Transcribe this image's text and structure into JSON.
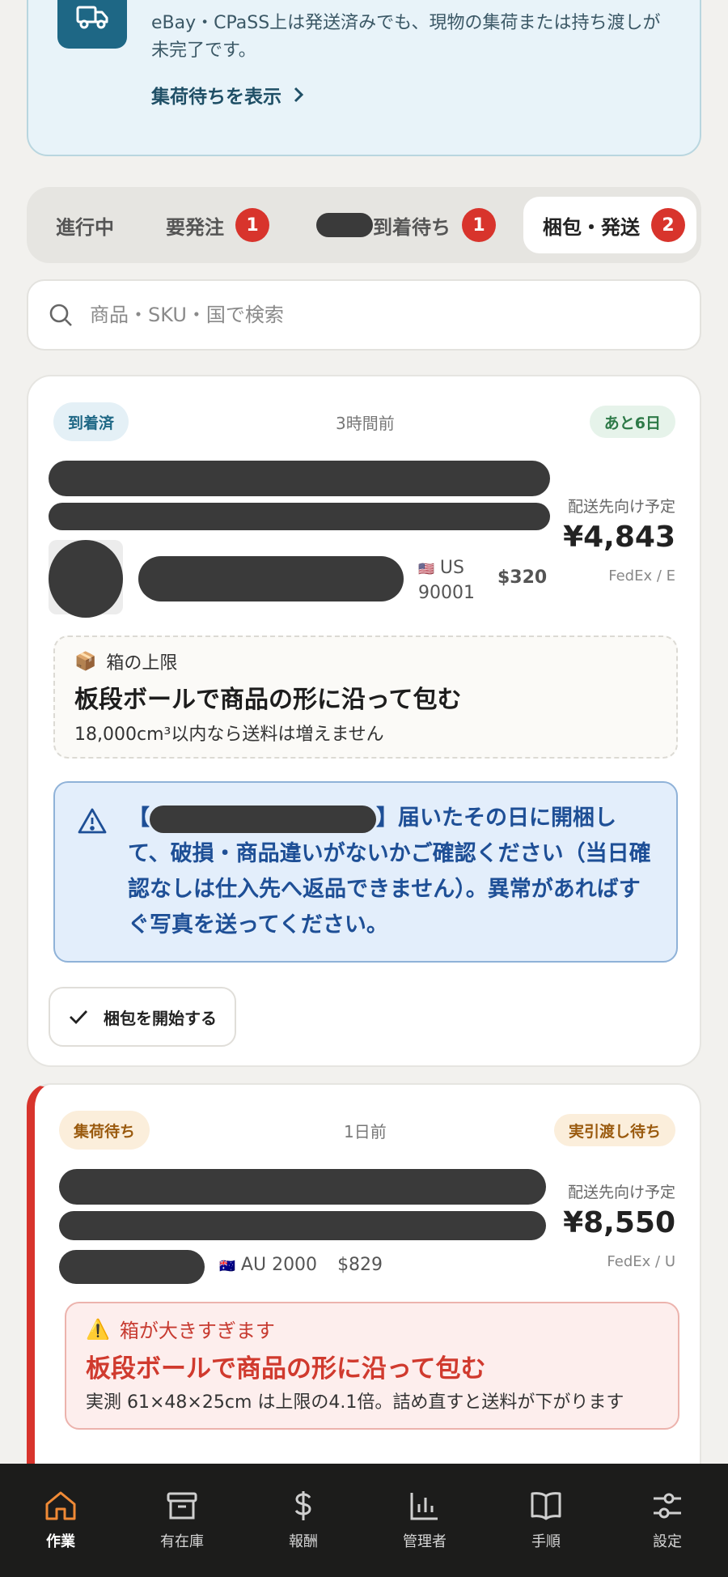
{
  "banner": {
    "message": "eBay・CPaSS上は発送済みでも、現物の集荷または持ち渡しが未完了です。",
    "link": "集荷待ちを表示"
  },
  "tabs": [
    {
      "label": "進行中",
      "badge": null
    },
    {
      "label": "要発注",
      "badge": "1"
    },
    {
      "label": "到着待ち",
      "badge": "1"
    },
    {
      "label": "梱包・発送",
      "badge": "2"
    }
  ],
  "search": {
    "placeholder": "商品・SKU・国で検索"
  },
  "card1": {
    "status": "到着済",
    "time_ago": "3時間前",
    "deadline": "あと6日",
    "dest_label": "配送先向け予定",
    "price": "¥4,843",
    "carrier": "FedEx / E",
    "country": "US",
    "postal": "90001",
    "sale": "$320",
    "box_label": "箱の上限",
    "box_title": "板段ボールで商品の形に沿って包む",
    "box_note": "18,000cm³以内なら送料は増えません",
    "warning_open": "【",
    "warning_rest": "】届いたその日に開梱して、破損・商品違いがないかご確認ください（当日確認なしは仕入先へ返品できません）。異常があればすぐ写真を送ってください。",
    "start_button": "梱包を開始する"
  },
  "card2": {
    "status": "集荷待ち",
    "time_ago": "1日前",
    "deadline": "実引渡し待ち",
    "dest_label": "配送先向け予定",
    "price": "¥8,550",
    "carrier": "FedEx / U",
    "country": "AU 2000",
    "sale": "$829",
    "alert_label": "箱が大きすぎます",
    "alert_title": "板段ボールで商品の形に沿って包む",
    "alert_note": "実測 61×48×25cm は上限の4.1倍。詰め直すと送料が下がります"
  },
  "nav": [
    {
      "label": "作業",
      "icon": "home-icon"
    },
    {
      "label": "有在庫",
      "icon": "archive-icon"
    },
    {
      "label": "報酬",
      "icon": "dollar-icon"
    },
    {
      "label": "管理者",
      "icon": "bar-chart-icon"
    },
    {
      "label": "手順",
      "icon": "book-icon"
    },
    {
      "label": "設定",
      "icon": "sliders-icon"
    }
  ],
  "colors": {
    "accent": "#f08a36",
    "badge": "#d8342c",
    "teal": "#1e6785"
  }
}
